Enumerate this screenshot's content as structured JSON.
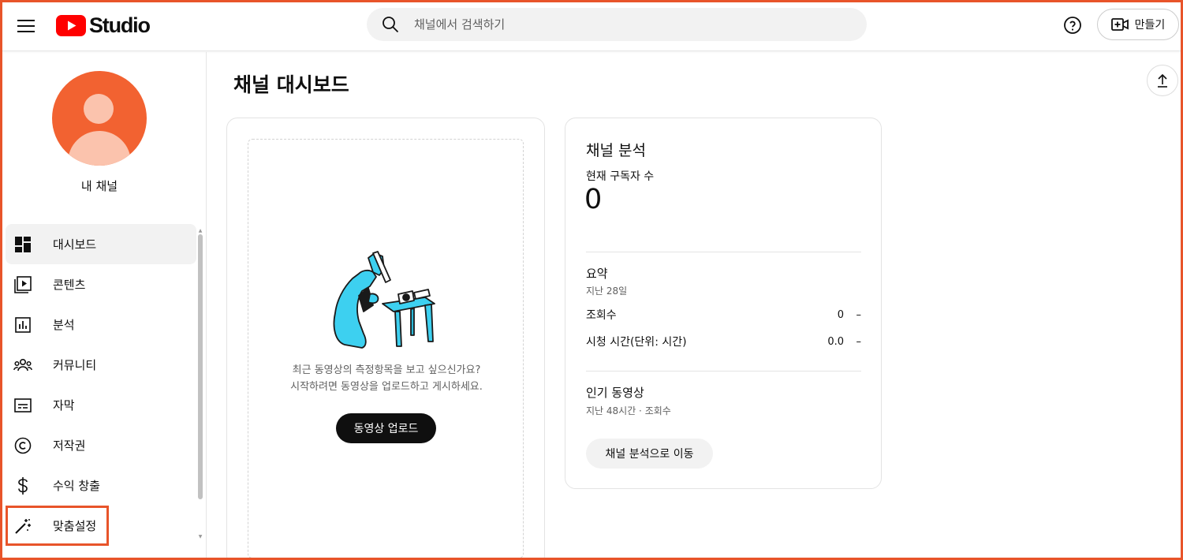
{
  "app": {
    "logo_text": "Studio",
    "brand_color": "#ff0000",
    "accent_frame_color": "#e8542a"
  },
  "header": {
    "search_placeholder": "채널에서 검색하기",
    "create_label": "만들기",
    "icons": [
      "menu-icon",
      "search-icon",
      "help-icon",
      "create-video-icon"
    ]
  },
  "sidebar": {
    "channel_name": "내 채널",
    "items": [
      {
        "label": "대시보드",
        "icon": "dashboard-icon",
        "active": true
      },
      {
        "label": "콘텐츠",
        "icon": "content-icon"
      },
      {
        "label": "분석",
        "icon": "analytics-icon"
      },
      {
        "label": "커뮤니티",
        "icon": "community-icon"
      },
      {
        "label": "자막",
        "icon": "subtitles-icon"
      },
      {
        "label": "저작권",
        "icon": "copyright-icon"
      },
      {
        "label": "수익 창출",
        "icon": "monetization-icon"
      },
      {
        "label": "맞춤설정",
        "icon": "customization-icon",
        "highlighted": true
      }
    ]
  },
  "main": {
    "title": "채널 대시보드",
    "upload_card": {
      "line1": "최근 동영상의 측정항목을 보고 싶으신가요?",
      "line2": "시작하려면 동영상을 업로드하고 게시하세요.",
      "button": "동영상 업로드"
    },
    "analytics_card": {
      "title": "채널 분석",
      "subscribers_label": "현재 구독자 수",
      "subscribers_value": "0",
      "summary_title": "요약",
      "summary_period": "지난 28일",
      "rows": [
        {
          "label": "조회수",
          "value": "0",
          "trend": "–"
        },
        {
          "label": "시청 시간(단위: 시간)",
          "value": "0.0",
          "trend": "–"
        }
      ],
      "top_videos_title": "인기 동영상",
      "top_videos_sub": "지난 48시간 · 조회수",
      "button": "채널 분석으로 이동"
    }
  }
}
